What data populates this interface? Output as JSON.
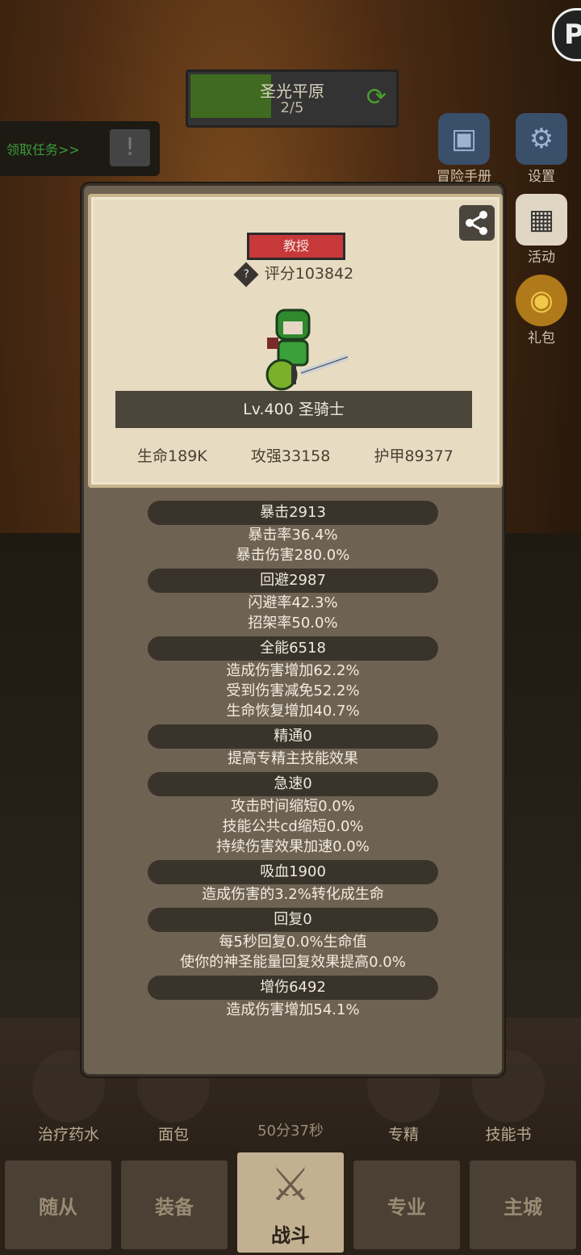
{
  "map": {
    "name": "圣光平原",
    "progress": "2/5"
  },
  "quest": {
    "label": "领取任务>>"
  },
  "side_buttons": {
    "adventure": "冒险手册",
    "settings": "设置",
    "activity": "活动",
    "gift": "礼包"
  },
  "dialog": {
    "rank": "教授",
    "score": "评分103842",
    "level_class": "Lv.400 圣骑士",
    "stats": {
      "hp": "生命189K",
      "atk": "攻强33158",
      "armor": "护甲89377"
    },
    "attributes": [
      {
        "header": "暴击2913",
        "lines": [
          "暴击率36.4%",
          "暴击伤害280.0%"
        ]
      },
      {
        "header": "回避2987",
        "lines": [
          "闪避率42.3%",
          "招架率50.0%"
        ]
      },
      {
        "header": "全能6518",
        "lines": [
          "造成伤害增加62.2%",
          "受到伤害减免52.2%",
          "生命恢复增加40.7%"
        ]
      },
      {
        "header": "精通0",
        "lines": [
          "提高专精主技能效果"
        ]
      },
      {
        "header": "急速0",
        "lines": [
          "攻击时间缩短0.0%",
          "技能公共cd缩短0.0%",
          "持续伤害效果加速0.0%"
        ]
      },
      {
        "header": "吸血1900",
        "lines": [
          "造成伤害的3.2%转化成生命"
        ]
      },
      {
        "header": "回复0",
        "lines": [
          "每5秒回复0.0%生命值",
          "使你的神圣能量回复效果提高0.0%"
        ]
      },
      {
        "header": "增伤6492",
        "lines": [
          "造成伤害增加54.1%"
        ]
      }
    ]
  },
  "bottom_items": {
    "potion": "治疗药水",
    "bread": "面包",
    "spec": "专精",
    "skillbook": "技能书"
  },
  "timer": "50分37秒",
  "nav": {
    "follower": "随从",
    "equip": "装备",
    "battle": "战斗",
    "profession": "专业",
    "city": "主城"
  }
}
